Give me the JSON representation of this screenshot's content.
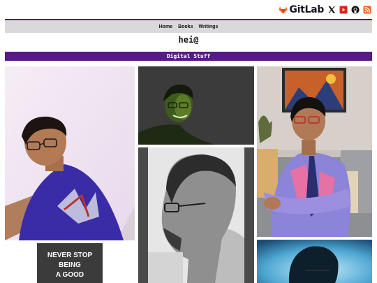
{
  "header": {
    "social": [
      {
        "name": "gitlab",
        "label": "GitLab",
        "color": "#e24329"
      },
      {
        "name": "x-twitter",
        "color": "#111111"
      },
      {
        "name": "youtube",
        "color": "#e62117"
      },
      {
        "name": "github",
        "color": "#111111"
      },
      {
        "name": "rss",
        "color": "#f26522"
      }
    ]
  },
  "nav": {
    "items": [
      {
        "label": "Home"
      },
      {
        "label": "Books"
      },
      {
        "label": "Writings"
      }
    ]
  },
  "site": {
    "title": "hei@"
  },
  "section": {
    "title": "Digital Stuff"
  },
  "gallery": {
    "quote_card": {
      "lines": [
        "NEVER STOP",
        "BEING",
        "A GOOD"
      ]
    }
  },
  "colors": {
    "nav_accent": "#4b1f7a",
    "section_bar": "#561c83",
    "nav_bg": "#d9d9d9"
  }
}
